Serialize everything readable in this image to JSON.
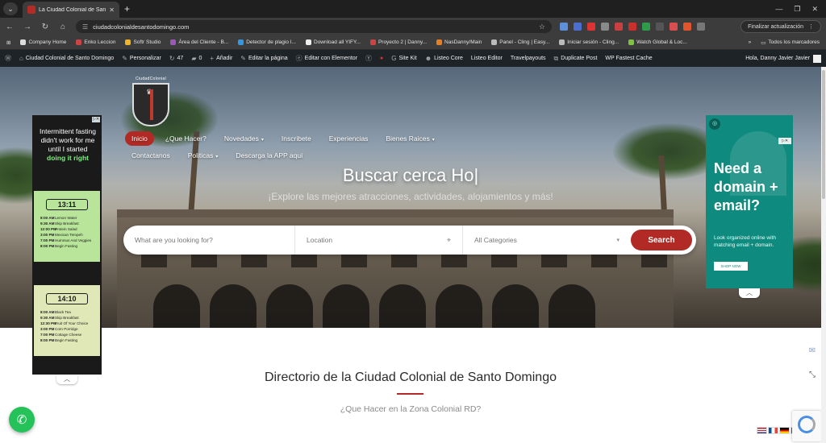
{
  "browser": {
    "tab_title": "La Ciudad Colonial de Santo Do...",
    "url": "ciudadcolonialdesantodomingo.com",
    "update_label": "Finalizar actualización",
    "bookmarks": [
      "Company Home",
      "Enko Leccion",
      "Softr Studio",
      "Área del Cliente - B...",
      "Detector de plagio I...",
      "Download all YIFY...",
      "Proyecto 2 | Danny...",
      "NasDanny/Main",
      "Panel - Cling | Easy...",
      "Iniciar sesión - Cling...",
      "Watch Global & Loc..."
    ],
    "bookmarks_all": "Todos los marcadores",
    "colors": {
      "tab_bar": "#1f1f1f",
      "toolbar": "#3c3c3c"
    }
  },
  "wp_admin": {
    "site_name": "Ciudad Colonial de Santo Domingo",
    "customize": "Personalizar",
    "updates_count": "47",
    "comments_count": "0",
    "add_new": "Añadir",
    "edit_page": "Editar la página",
    "edit_elementor": "Editar con Elementor",
    "site_kit": "Site Kit",
    "listeo_core": "Listeo Core",
    "listeo_editor": "Listeo Editor",
    "travelpayouts": "Travelpayouts",
    "duplicate_post": "Duplicate Post",
    "fastest_cache": "WP Fastest Cache",
    "howdy": "Hola, Danny Javier Javier"
  },
  "site": {
    "logo_text": "CiudadColonial",
    "nav_row1": [
      {
        "label": "Inicio",
        "active": true,
        "caret": false
      },
      {
        "label": "¿Que Hacer?",
        "active": false,
        "caret": false
      },
      {
        "label": "Novedades",
        "active": false,
        "caret": true
      },
      {
        "label": "Inscribete",
        "active": false,
        "caret": false
      },
      {
        "label": "Experiencias",
        "active": false,
        "caret": false
      },
      {
        "label": "Bienes Raices",
        "active": false,
        "caret": true
      }
    ],
    "nav_row2": [
      {
        "label": "Contactanos",
        "caret": false
      },
      {
        "label": "Politicas",
        "caret": true
      },
      {
        "label": "Descarga la APP aquí",
        "caret": false
      }
    ],
    "hero_title": "Buscar cerca Ho|",
    "hero_subtitle": "¡Explore las mejores atracciones, actividades, alojamientos y más!",
    "search": {
      "placeholder": "What are you looking for?",
      "location_placeholder": "Location",
      "category": "All Categories",
      "button": "Search"
    },
    "directory_title": "Directorio de la Ciudad Colonial de Santo Domingo",
    "directory_subtitle": "¿Que Hacer en la Zona Colonial RD?",
    "accent_color": "#b22a25"
  },
  "ad_left": {
    "headline_1": "Intermittent fasting didn't work for me until I started",
    "headline_2": "doing it right",
    "plan1_time": "13:11",
    "plan1_rows": [
      [
        "8:00 AM",
        "Lemon Water"
      ],
      [
        "9:30 AM",
        "Skip Breakfast"
      ],
      [
        "12:00 PM",
        "Protein Salad"
      ],
      [
        "3:00 PM",
        "Mexican Tempeh"
      ],
      [
        "7:00 PM",
        "Hummus And Veggies"
      ],
      [
        "8:00 PM",
        "Begin Fasting"
      ]
    ],
    "plan2_time": "14:10",
    "plan2_rows": [
      [
        "8:00 AM",
        "Black Tea"
      ],
      [
        "9:30 AM",
        "Skip Breakfast"
      ],
      [
        "12:30 PM",
        "Fruit Of Your Choice"
      ],
      [
        "3:00 PM",
        "Corn Porridge"
      ],
      [
        "7:00 PM",
        "Cottage Cheese"
      ],
      [
        "8:00 PM",
        "Begin Fasting"
      ]
    ]
  },
  "ad_right": {
    "headline": "Need a domain + email?",
    "body": "Look organized online with matching email + domain.",
    "cta": "SHOP NOW"
  }
}
